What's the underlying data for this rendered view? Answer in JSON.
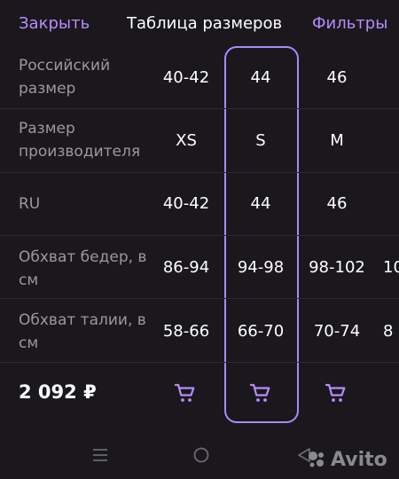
{
  "header": {
    "close_label": "Закрыть",
    "title": "Таблица размеров",
    "filters_label": "Фильтры"
  },
  "rows": [
    {
      "label": "Российский размер",
      "values": [
        "40-42",
        "44",
        "46",
        ""
      ]
    },
    {
      "label": "Размер производителя",
      "values": [
        "XS",
        "S",
        "M",
        ""
      ]
    },
    {
      "label": "RU",
      "values": [
        "40-42",
        "44",
        "46",
        ""
      ]
    },
    {
      "label": "Обхват бедер, в см",
      "values": [
        "86-94",
        "94-98",
        "98-102",
        "10"
      ]
    },
    {
      "label": "Обхват талии, в см",
      "values": [
        "58-66",
        "66-70",
        "70-74",
        "8"
      ]
    }
  ],
  "footer": {
    "price": "2 092 ₽"
  },
  "selected_column": "44",
  "colors": {
    "accent": "#b88bff",
    "background": "#1a181c",
    "label": "#9b98a0"
  },
  "icons": [
    "cart-icon",
    "menu-icon",
    "home-icon",
    "back-icon"
  ],
  "watermark": {
    "text": "Avito"
  }
}
